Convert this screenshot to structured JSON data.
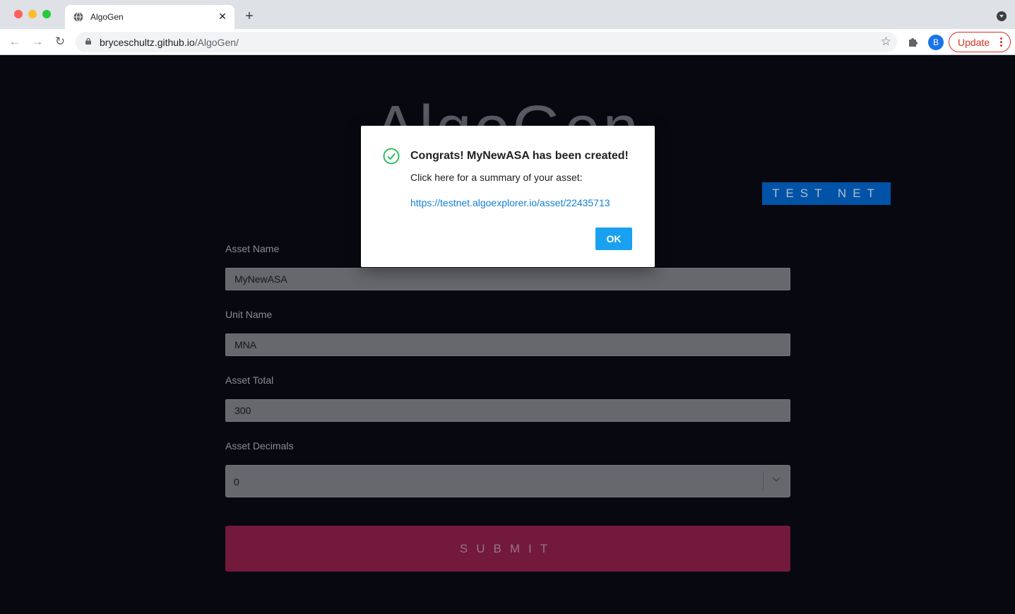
{
  "browser": {
    "tab_title": "AlgoGen",
    "url_host": "bryceschultz.github.io",
    "url_path": "/AlgoGen/",
    "avatar_letter": "B",
    "update_label": "Update"
  },
  "page": {
    "logo_text": "AlgoGen",
    "network_badge": "TEST NET",
    "fields": {
      "asset_name": {
        "label": "Asset Name",
        "value": "MyNewASA"
      },
      "unit_name": {
        "label": "Unit Name",
        "value": "MNA"
      },
      "asset_total": {
        "label": "Asset Total",
        "value": "300"
      },
      "asset_decimals": {
        "label": "Asset Decimals",
        "value": "0"
      }
    },
    "submit_label": "SUBMIT"
  },
  "dialog": {
    "title": "Congrats! MyNewASA has been created!",
    "body": "Click here for a summary of your asset:",
    "link": "https://testnet.algoexplorer.io/asset/22435713",
    "ok_label": "OK"
  },
  "colors": {
    "page_bg": "#0a0b14",
    "badge": "#0066cc",
    "submit": "#8b1f4a",
    "ok_button": "#1aa0f0",
    "success": "#1db954"
  }
}
